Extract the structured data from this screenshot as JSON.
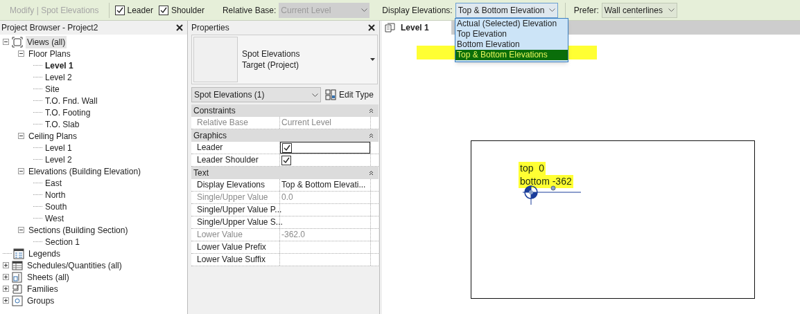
{
  "toolbar": {
    "context": "Modify | Spot Elevations",
    "checkboxes": [
      {
        "label": "Leader",
        "checked": true
      },
      {
        "label": "Shoulder",
        "checked": true
      }
    ],
    "relative_base": {
      "label": "Relative Base:",
      "value": "Current Level",
      "disabled": true
    },
    "display_elevations": {
      "label": "Display Elevations:",
      "value": "Top & Bottom Elevation",
      "expanded": true,
      "options": [
        {
          "label": "Actual (Selected) Elevation",
          "selected": false
        },
        {
          "label": "Top Elevation",
          "selected": false
        },
        {
          "label": "Bottom Elevation",
          "selected": false
        },
        {
          "label": "Top & Bottom Elevations",
          "selected": true
        }
      ]
    },
    "prefer": {
      "label": "Prefer:",
      "value": "Wall centerlines"
    }
  },
  "project_browser": {
    "title": "Project Browser - Project2",
    "tree": [
      {
        "label": "Views (all)",
        "kind": "views",
        "expanded": true,
        "current": false,
        "children": [
          {
            "label": "Floor Plans",
            "expanded": true,
            "current": false,
            "children": [
              {
                "label": "Level 1",
                "current": true
              },
              {
                "label": "Level 2",
                "current": false
              },
              {
                "label": "Site",
                "current": false
              },
              {
                "label": "T.O. Fnd. Wall",
                "current": false
              },
              {
                "label": "T.O. Footing",
                "current": false
              },
              {
                "label": "T.O. Slab",
                "current": false
              }
            ]
          },
          {
            "label": "Ceiling Plans",
            "expanded": true,
            "current": false,
            "children": [
              {
                "label": "Level 1",
                "current": false
              },
              {
                "label": "Level 2",
                "current": false
              }
            ]
          },
          {
            "label": "Elevations (Building Elevation)",
            "expanded": true,
            "current": false,
            "children": [
              {
                "label": "East",
                "current": false
              },
              {
                "label": "North",
                "current": false
              },
              {
                "label": "South",
                "current": false
              },
              {
                "label": "West",
                "current": false
              }
            ]
          },
          {
            "label": "Sections (Building Section)",
            "expanded": true,
            "current": false,
            "children": [
              {
                "label": "Section 1",
                "current": false
              }
            ]
          }
        ]
      },
      {
        "label": "Legends",
        "kind": "legends",
        "current": false
      },
      {
        "label": "Schedules/Quantities (all)",
        "kind": "schedules",
        "expanded": false,
        "current": false
      },
      {
        "label": "Sheets (all)",
        "kind": "sheets",
        "expanded": false,
        "current": false
      },
      {
        "label": "Families",
        "kind": "families",
        "expanded": false,
        "current": false
      },
      {
        "label": "Groups",
        "kind": "groups",
        "expanded": false,
        "current": false
      }
    ]
  },
  "properties": {
    "title": "Properties",
    "type_name": "Spot Elevations",
    "type_subname": "Target (Project)",
    "instance_filter": "Spot Elevations (1)",
    "edit_type": "Edit Type",
    "groups": [
      {
        "name": "Constraints",
        "rows": [
          {
            "name": "Relative Base",
            "kind": "text",
            "value": "Current Level",
            "disabled": true,
            "selected": false
          }
        ]
      },
      {
        "name": "Graphics",
        "rows": [
          {
            "name": "Leader",
            "kind": "checkbox",
            "checked": true,
            "disabled": false,
            "selected": true
          },
          {
            "name": "Leader Shoulder",
            "kind": "checkbox",
            "checked": true,
            "disabled": false,
            "selected": false
          }
        ]
      },
      {
        "name": "Text",
        "rows": [
          {
            "name": "Display Elevations",
            "kind": "text",
            "value": "Top & Bottom Elevati...",
            "disabled": false,
            "selected": false
          },
          {
            "name": "Single/Upper Value",
            "kind": "text",
            "value": "0.0",
            "disabled": true,
            "selected": false
          },
          {
            "name": "Single/Upper Value P...",
            "kind": "text",
            "disabled": false,
            "selected": false
          },
          {
            "name": "Single/Upper Value S...",
            "kind": "text",
            "disabled": false,
            "selected": false
          },
          {
            "name": "Lower Value",
            "kind": "text",
            "value": "-362.0",
            "disabled": true,
            "selected": false
          },
          {
            "name": "Lower Value Prefix",
            "kind": "text",
            "disabled": false,
            "selected": false
          },
          {
            "name": "Lower Value Suffix",
            "kind": "text",
            "disabled": false,
            "selected": false
          }
        ]
      }
    ]
  },
  "view": {
    "tab": "Level 1",
    "spot_labels": [
      "top  0",
      "bottom -362"
    ]
  }
}
